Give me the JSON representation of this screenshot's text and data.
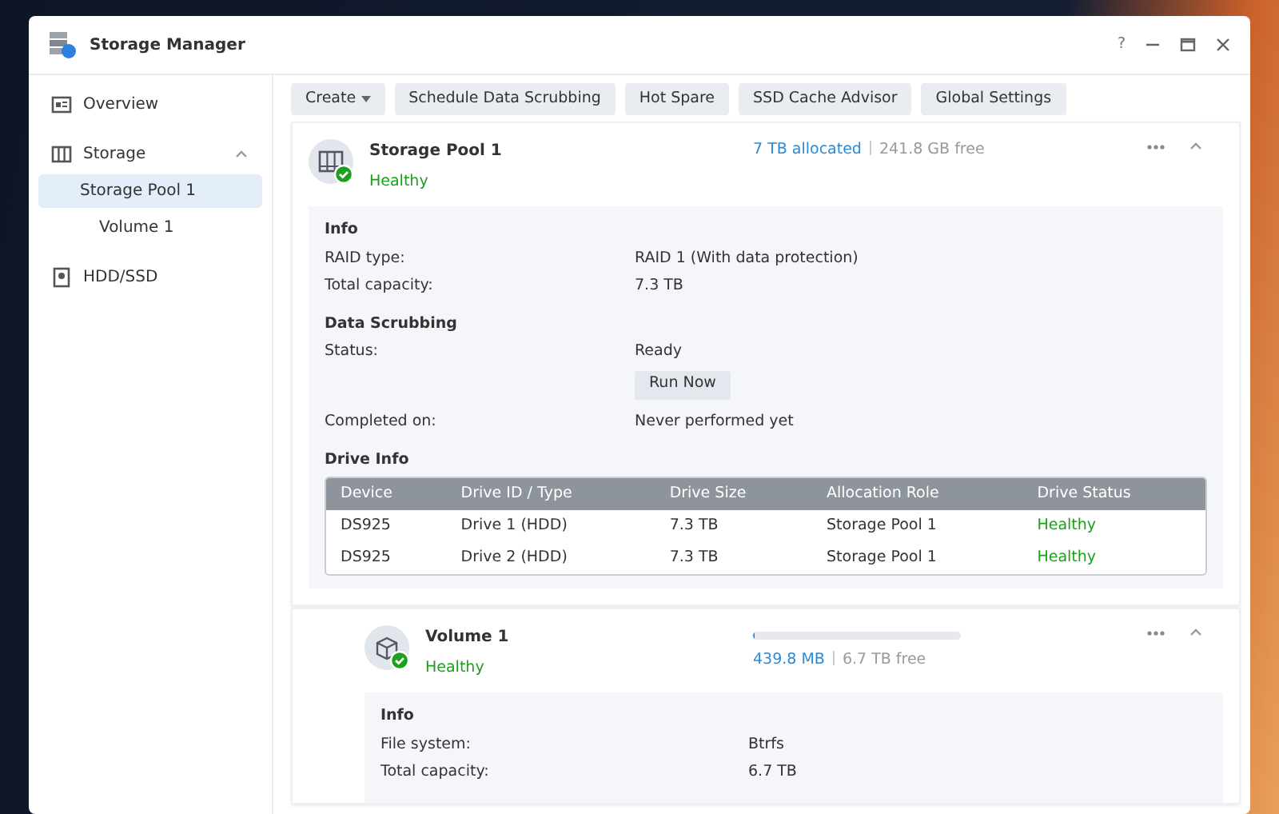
{
  "window": {
    "title": "Storage Manager",
    "help": "?"
  },
  "sidebar": {
    "items": [
      {
        "label": "Overview",
        "selected": false
      },
      {
        "label": "Storage",
        "selected": false,
        "expanded": true,
        "children": [
          {
            "label": "Storage Pool 1",
            "selected": true,
            "children": [
              {
                "label": "Volume 1",
                "selected": false
              }
            ]
          }
        ]
      },
      {
        "label": "HDD/SSD",
        "selected": false
      }
    ]
  },
  "toolbar": [
    {
      "label": "Create",
      "dropdown": true
    },
    {
      "label": "Schedule Data Scrubbing",
      "dropdown": false
    },
    {
      "label": "Hot Spare",
      "dropdown": false
    },
    {
      "label": "SSD Cache Advisor",
      "dropdown": false
    },
    {
      "label": "Global Settings",
      "dropdown": false
    }
  ],
  "pool": {
    "title": "Storage Pool 1",
    "status": "Healthy",
    "allocated": "7 TB allocated",
    "free": "241.8 GB free",
    "expanded": true,
    "sections": [
      {
        "heading": "Info",
        "rows": [
          {
            "label": "RAID type:",
            "value": "RAID 1 (With data protection)"
          },
          {
            "label": "Total capacity:",
            "value": "7.3 TB"
          }
        ]
      },
      {
        "heading": "Data Scrubbing",
        "rows": [
          {
            "label": "Status:",
            "value": "Ready",
            "button": "Run Now"
          },
          {
            "label": "Completed on:",
            "value": "Never performed yet"
          }
        ]
      }
    ],
    "drive_info": {
      "heading": "Drive Info",
      "columns": [
        "Device",
        "Drive ID / Type",
        "Drive Size",
        "Allocation Role",
        "Drive Status"
      ],
      "rows": [
        {
          "cells": [
            "DS925",
            "Drive 1 (HDD)",
            "7.3 TB",
            "Storage Pool 1"
          ],
          "status": "Healthy"
        },
        {
          "cells": [
            "DS925",
            "Drive 2 (HDD)",
            "7.3 TB",
            "Storage Pool 1"
          ],
          "status": "Healthy"
        }
      ]
    }
  },
  "volume": {
    "title": "Volume 1",
    "status": "Healthy",
    "level": 0.01,
    "used": "439.8 MB",
    "free": "6.7 TB free",
    "expanded": true,
    "sections": [
      {
        "heading": "Info",
        "rows": [
          {
            "label": "File system:",
            "value": "Btrfs"
          },
          {
            "label": "Total capacity:",
            "value": "6.7 TB"
          }
        ]
      }
    ]
  }
}
